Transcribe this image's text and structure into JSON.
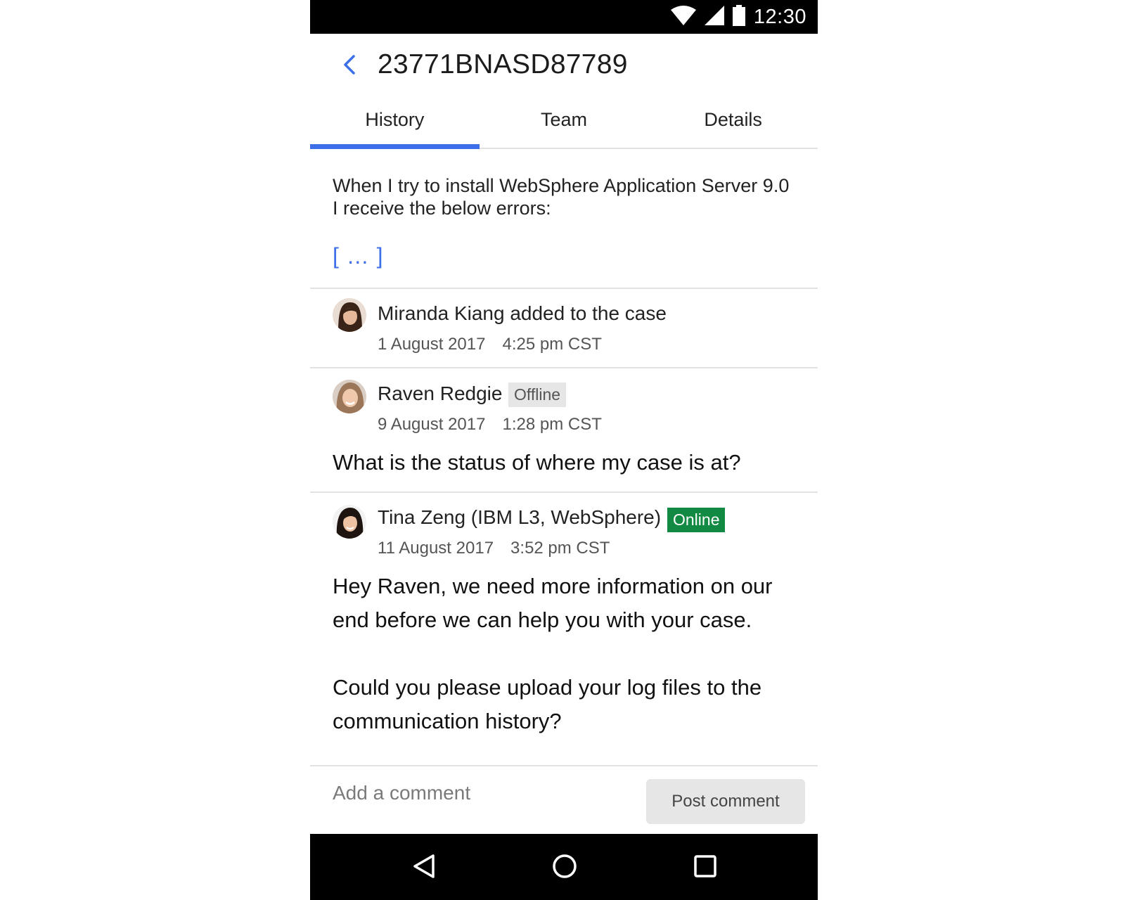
{
  "status_bar": {
    "time": "12:30",
    "icons": [
      "wifi-icon",
      "cellular-signal-icon",
      "battery-icon"
    ]
  },
  "header": {
    "title": "23771BNASD87789",
    "back_icon": "chevron-left-icon"
  },
  "tabs": [
    {
      "label": "History",
      "active": true
    },
    {
      "label": "Team",
      "active": false
    },
    {
      "label": "Details",
      "active": false
    }
  ],
  "case": {
    "description": "When I try to install WebSphere Application Server 9.0 I receive the below errors:",
    "more_link": "[ … ]"
  },
  "history": [
    {
      "name": "Miranda Kiang added to the case",
      "date": "1 August 2017",
      "time": "4:25 pm CST"
    },
    {
      "name": "Raven Redgie",
      "status": "Offline",
      "date": "9 August 2017",
      "time": "1:28 pm CST",
      "message": "What is the status of where my case is at?"
    },
    {
      "name": "Tina Zeng (IBM L3, WebSphere)",
      "status": "Online",
      "date": "11 August 2017",
      "time": "3:52 pm CST",
      "message_line1": "Hey Raven, we need more information on our end before we can help you with your case.",
      "message_line2": "Could you please upload your log files to the communication history?"
    }
  ],
  "comment": {
    "placeholder": "Add a comment",
    "post_label": "Post comment"
  },
  "colors": {
    "accent": "#3d6fe8",
    "online": "#138a43",
    "offline_bg": "#e6e6e6"
  },
  "nav_bar": [
    "back-triangle-icon",
    "home-circle-icon",
    "recents-square-icon"
  ]
}
